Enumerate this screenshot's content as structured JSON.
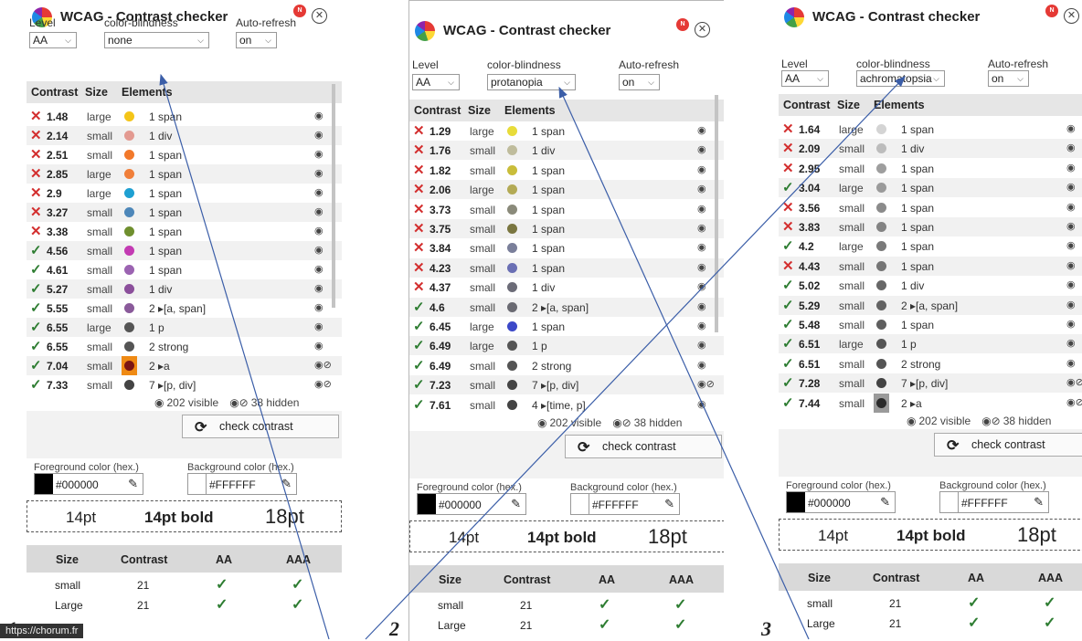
{
  "panels": [
    {
      "number": "1",
      "title": "WCAG - Contrast checker",
      "notification": "N",
      "level_label": "Level",
      "level_value": "AA",
      "cb_label": "color-blindness",
      "cb_value": "none",
      "ar_label": "Auto-refresh",
      "ar_value": "on",
      "headers": {
        "contrast": "Contrast",
        "size": "Size",
        "elements": "Elements"
      },
      "rows": [
        {
          "v": "1.48",
          "s": "large",
          "e": "1 span",
          "ok": false,
          "c": "#f4c518",
          "h": false
        },
        {
          "v": "2.14",
          "s": "small",
          "e": "1 div",
          "ok": false,
          "c": "#e39a91",
          "h": false
        },
        {
          "v": "2.51",
          "s": "small",
          "e": "1 span",
          "ok": false,
          "c": "#f2792b",
          "h": false
        },
        {
          "v": "2.85",
          "s": "large",
          "e": "1 span",
          "ok": false,
          "c": "#f07f3a",
          "h": false
        },
        {
          "v": "2.9",
          "s": "large",
          "e": "1 span",
          "ok": false,
          "c": "#1ea0d2",
          "h": false
        },
        {
          "v": "3.27",
          "s": "small",
          "e": "1 span",
          "ok": false,
          "c": "#4d87b9",
          "h": false
        },
        {
          "v": "3.38",
          "s": "small",
          "e": "1 span",
          "ok": false,
          "c": "#6f8f2e",
          "h": false
        },
        {
          "v": "4.56",
          "s": "small",
          "e": "1 span",
          "ok": true,
          "c": "#c33bb3",
          "h": false
        },
        {
          "v": "4.61",
          "s": "small",
          "e": "1 span",
          "ok": true,
          "c": "#9b63b1",
          "h": false
        },
        {
          "v": "5.27",
          "s": "small",
          "e": "1 div",
          "ok": true,
          "c": "#8b4f9b",
          "h": false
        },
        {
          "v": "5.55",
          "s": "small",
          "e": "2 ▸[a, span]",
          "ok": true,
          "c": "#8a5a9a",
          "h": false
        },
        {
          "v": "6.55",
          "s": "large",
          "e": "1 p",
          "ok": true,
          "c": "#555555",
          "h": false
        },
        {
          "v": "6.55",
          "s": "small",
          "e": "2 strong",
          "ok": true,
          "c": "#555555",
          "h": false
        },
        {
          "v": "7.04",
          "s": "small",
          "e": "2 ▸a",
          "ok": true,
          "c": "#7a1414",
          "bg": "#ef8a14",
          "h": true
        },
        {
          "v": "7.33",
          "s": "small",
          "e": "7 ▸[p, div]",
          "ok": true,
          "c": "#444444",
          "h": true
        }
      ],
      "visible": "202 visible",
      "hidden": "38 hidden",
      "check_label": "check contrast",
      "fg_label": "Foreground color (hex.)",
      "fg_value": "#000000",
      "bg_label": "Background color (hex.)",
      "bg_value": "#FFFFFF",
      "s14": "14pt",
      "s14b": "14pt bold",
      "s18": "18pt",
      "res_headers": {
        "size": "Size",
        "contrast": "Contrast",
        "aa": "AA",
        "aaa": "AAA"
      },
      "res_rows": [
        {
          "size": "small",
          "contrast": "21"
        },
        {
          "size": "Large",
          "contrast": "21"
        }
      ],
      "url": "https://chorum.fr"
    },
    {
      "number": "2",
      "title": "WCAG - Contrast checker",
      "notification": "N",
      "level_label": "Level",
      "level_value": "AA",
      "cb_label": "color-blindness",
      "cb_value": "protanopia",
      "ar_label": "Auto-refresh",
      "ar_value": "on",
      "headers": {
        "contrast": "Contrast",
        "size": "Size",
        "elements": "Elements"
      },
      "rows": [
        {
          "v": "1.29",
          "s": "large",
          "e": "1 span",
          "ok": false,
          "c": "#e8dc3a",
          "h": false
        },
        {
          "v": "1.76",
          "s": "small",
          "e": "1 div",
          "ok": false,
          "c": "#bfbc9c",
          "h": false
        },
        {
          "v": "1.82",
          "s": "small",
          "e": "1 span",
          "ok": false,
          "c": "#c9bd3a",
          "h": false
        },
        {
          "v": "2.06",
          "s": "large",
          "e": "1 span",
          "ok": false,
          "c": "#b3aa55",
          "h": false
        },
        {
          "v": "3.73",
          "s": "small",
          "e": "1 span",
          "ok": false,
          "c": "#8a8a7a",
          "h": false
        },
        {
          "v": "3.75",
          "s": "small",
          "e": "1 span",
          "ok": false,
          "c": "#7a7640",
          "h": false
        },
        {
          "v": "3.84",
          "s": "small",
          "e": "1 span",
          "ok": false,
          "c": "#7a7f9a",
          "h": false
        },
        {
          "v": "4.23",
          "s": "small",
          "e": "1 span",
          "ok": false,
          "c": "#6a6fb4",
          "h": false
        },
        {
          "v": "4.37",
          "s": "small",
          "e": "1 div",
          "ok": false,
          "c": "#6c6c78",
          "h": false
        },
        {
          "v": "4.6",
          "s": "small",
          "e": "2 ▸[a, span]",
          "ok": true,
          "c": "#6a6a72",
          "h": false
        },
        {
          "v": "6.45",
          "s": "large",
          "e": "1 span",
          "ok": true,
          "c": "#3c48c8",
          "h": false
        },
        {
          "v": "6.49",
          "s": "large",
          "e": "1 p",
          "ok": true,
          "c": "#555555",
          "h": false
        },
        {
          "v": "6.49",
          "s": "small",
          "e": "2 strong",
          "ok": true,
          "c": "#555555",
          "h": false
        },
        {
          "v": "7.23",
          "s": "small",
          "e": "7 ▸[p, div]",
          "ok": true,
          "c": "#444444",
          "h": true
        },
        {
          "v": "7.61",
          "s": "small",
          "e": "4 ▸[time, p]",
          "ok": true,
          "c": "#444444",
          "h": false
        }
      ],
      "visible": "202 visible",
      "hidden": "38 hidden",
      "check_label": "check contrast",
      "fg_label": "Foreground color (hex.)",
      "fg_value": "#000000",
      "bg_label": "Background color (hex.)",
      "bg_value": "#FFFFFF",
      "s14": "14pt",
      "s14b": "14pt bold",
      "s18": "18pt",
      "res_headers": {
        "size": "Size",
        "contrast": "Contrast",
        "aa": "AA",
        "aaa": "AAA"
      },
      "res_rows": [
        {
          "size": "small",
          "contrast": "21"
        },
        {
          "size": "Large",
          "contrast": "21"
        }
      ]
    },
    {
      "number": "3",
      "title": "WCAG - Contrast checker",
      "notification": "N",
      "level_label": "Level",
      "level_value": "AA",
      "cb_label": "color-blindness",
      "cb_value": "achromatopsia",
      "ar_label": "Auto-refresh",
      "ar_value": "on",
      "headers": {
        "contrast": "Contrast",
        "size": "Size",
        "elements": "Elements"
      },
      "rows": [
        {
          "v": "1.64",
          "s": "large",
          "e": "1 span",
          "ok": false,
          "c": "#d4d4d4",
          "h": false
        },
        {
          "v": "2.09",
          "s": "small",
          "e": "1 div",
          "ok": false,
          "c": "#bcbcbc",
          "h": false
        },
        {
          "v": "2.95",
          "s": "small",
          "e": "1 span",
          "ok": false,
          "c": "#9e9e9e",
          "h": false
        },
        {
          "v": "3.04",
          "s": "large",
          "e": "1 span",
          "ok": true,
          "c": "#9a9a9a",
          "h": false
        },
        {
          "v": "3.56",
          "s": "small",
          "e": "1 span",
          "ok": false,
          "c": "#8b8b8b",
          "h": false
        },
        {
          "v": "3.83",
          "s": "small",
          "e": "1 span",
          "ok": false,
          "c": "#838383",
          "h": false
        },
        {
          "v": "4.2",
          "s": "large",
          "e": "1 span",
          "ok": true,
          "c": "#7a7a7a",
          "h": false
        },
        {
          "v": "4.43",
          "s": "small",
          "e": "1 span",
          "ok": false,
          "c": "#757575",
          "h": false
        },
        {
          "v": "5.02",
          "s": "small",
          "e": "1 div",
          "ok": true,
          "c": "#676767",
          "h": false
        },
        {
          "v": "5.29",
          "s": "small",
          "e": "2 ▸[a, span]",
          "ok": true,
          "c": "#636363",
          "h": false
        },
        {
          "v": "5.48",
          "s": "small",
          "e": "1 span",
          "ok": true,
          "c": "#5f5f5f",
          "h": false
        },
        {
          "v": "6.51",
          "s": "large",
          "e": "1 p",
          "ok": true,
          "c": "#555555",
          "h": false
        },
        {
          "v": "6.51",
          "s": "small",
          "e": "2 strong",
          "ok": true,
          "c": "#555555",
          "h": false
        },
        {
          "v": "7.28",
          "s": "small",
          "e": "7 ▸[p, div]",
          "ok": true,
          "c": "#444444",
          "h": true
        },
        {
          "v": "7.44",
          "s": "small",
          "e": "2 ▸a",
          "ok": true,
          "c": "#2b2b2b",
          "bg": "#9a9a9a",
          "h": true
        }
      ],
      "visible": "202 visible",
      "hidden": "38 hidden",
      "check_label": "check contrast",
      "fg_label": "Foreground color (hex.)",
      "fg_value": "#000000",
      "bg_label": "Background color (hex.)",
      "bg_value": "#FFFFFF",
      "s14": "14pt",
      "s14b": "14pt bold",
      "s18": "18pt",
      "res_headers": {
        "size": "Size",
        "contrast": "Contrast",
        "aa": "AA",
        "aaa": "AAA"
      },
      "res_rows": [
        {
          "size": "small",
          "contrast": "21"
        },
        {
          "size": "Large",
          "contrast": "21"
        }
      ]
    }
  ],
  "icons": {
    "fail": "✕",
    "pass": "✓",
    "eye": "◉",
    "eye_hidden": "◉⊘",
    "refresh": "⟳",
    "picker": "✎",
    "chevron": "⌵",
    "close": "✕"
  },
  "colors": {
    "fail": "#d32f2f",
    "pass": "#2e7d32",
    "arrow": "#3b5ea8",
    "badge": "#e53935"
  }
}
